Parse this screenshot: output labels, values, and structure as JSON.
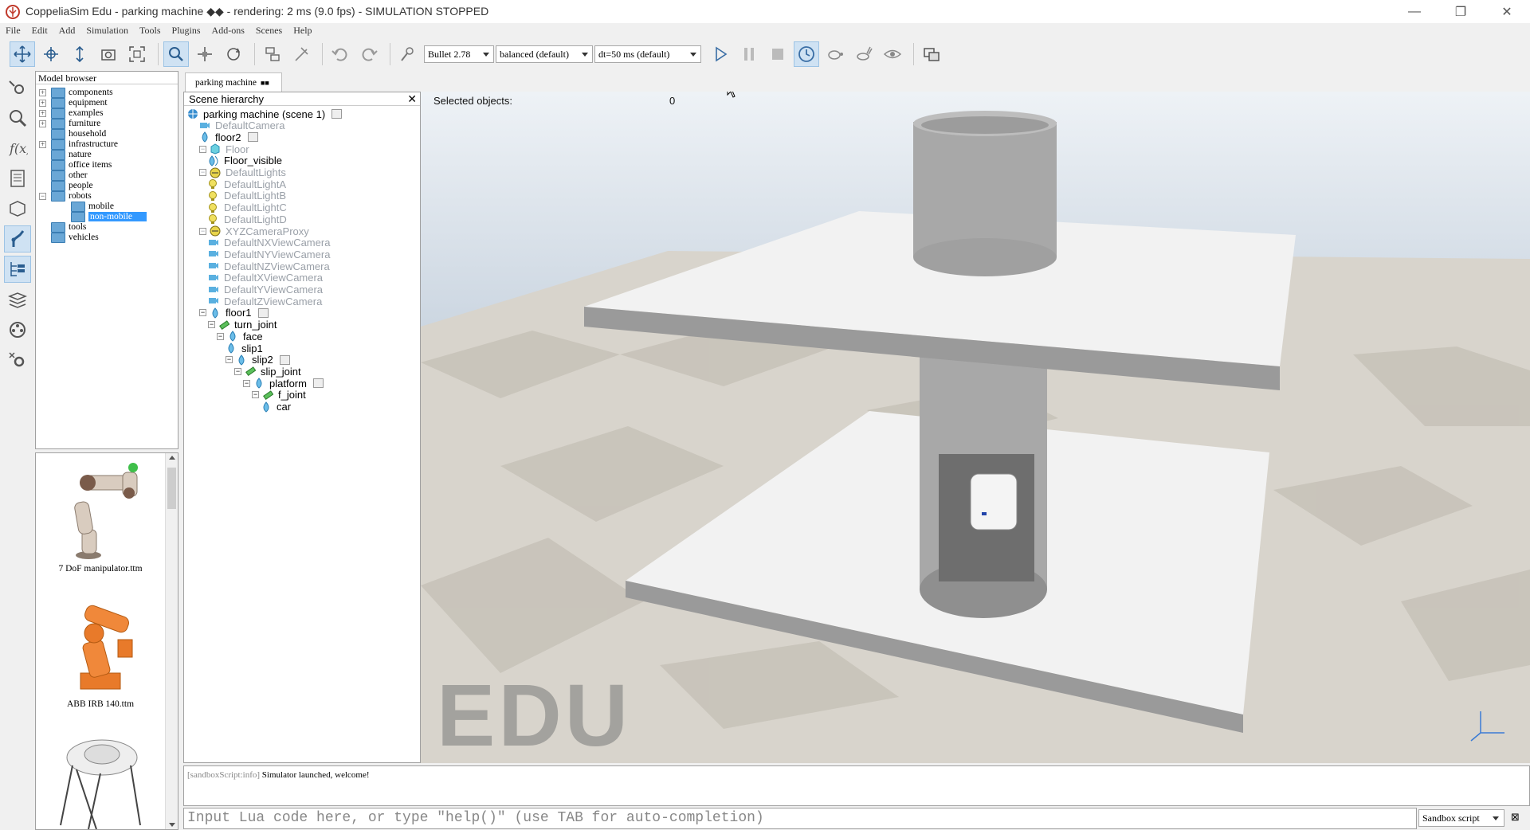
{
  "window": {
    "title": "CoppeliaSim Edu - parking machine ◆◆ - rendering: 2 ms (9.0 fps) - SIMULATION STOPPED"
  },
  "menu": [
    "File",
    "Edit",
    "Add",
    "Simulation",
    "Tools",
    "Plugins",
    "Add-ons",
    "Scenes",
    "Help"
  ],
  "toolbar": {
    "engine": "Bullet 2.78",
    "accuracy": "balanced (default)",
    "timestep": "dt=50 ms (default)"
  },
  "model_browser": {
    "title": "Model browser",
    "items": [
      {
        "label": "components",
        "expandable": true
      },
      {
        "label": "equipment",
        "expandable": true
      },
      {
        "label": "examples",
        "expandable": true
      },
      {
        "label": "furniture",
        "expandable": true
      },
      {
        "label": "household",
        "expandable": false
      },
      {
        "label": "infrastructure",
        "expandable": true
      },
      {
        "label": "nature",
        "expandable": false
      },
      {
        "label": "office items",
        "expandable": false
      },
      {
        "label": "other",
        "expandable": false
      },
      {
        "label": "people",
        "expandable": false
      },
      {
        "label": "robots",
        "expandable": true,
        "expanded": true
      },
      {
        "label": "mobile",
        "child": true
      },
      {
        "label": "non-mobile",
        "child": true,
        "selected": true
      },
      {
        "label": "tools",
        "expandable": false
      },
      {
        "label": "vehicles",
        "expandable": false
      }
    ]
  },
  "thumbnails": [
    {
      "label": "7 DoF manipulator.ttm"
    },
    {
      "label": "ABB IRB 140.ttm"
    }
  ],
  "doc_tab": {
    "label": "parking machine"
  },
  "scene_hierarchy": {
    "title": "Scene hierarchy",
    "rows": [
      {
        "label": "parking machine (scene 1)"
      },
      {
        "label": "DefaultCamera"
      },
      {
        "label": "floor2"
      },
      {
        "label": "Floor"
      },
      {
        "label": "Floor_visible"
      },
      {
        "label": "DefaultLights"
      },
      {
        "label": "DefaultLightA"
      },
      {
        "label": "DefaultLightB"
      },
      {
        "label": "DefaultLightC"
      },
      {
        "label": "DefaultLightD"
      },
      {
        "label": "XYZCameraProxy"
      },
      {
        "label": "DefaultNXViewCamera"
      },
      {
        "label": "DefaultNYViewCamera"
      },
      {
        "label": "DefaultNZViewCamera"
      },
      {
        "label": "DefaultXViewCamera"
      },
      {
        "label": "DefaultYViewCamera"
      },
      {
        "label": "DefaultZViewCamera"
      },
      {
        "label": "floor1"
      },
      {
        "label": "turn_joint"
      },
      {
        "label": "face"
      },
      {
        "label": "slip1"
      },
      {
        "label": "slip2"
      },
      {
        "label": "slip_joint"
      },
      {
        "label": "platform"
      },
      {
        "label": "f_joint"
      },
      {
        "label": "car"
      }
    ]
  },
  "viewport": {
    "selected_label": "Selected objects:",
    "selected_count": "0",
    "watermark": "EDU"
  },
  "console": {
    "tag": "[sandboxScript:info]",
    "message": " Simulator launched, welcome!",
    "input_placeholder": "Input Lua code here, or type \"help()\" (use TAB for auto-completion)",
    "script_mode": "Sandbox script"
  }
}
